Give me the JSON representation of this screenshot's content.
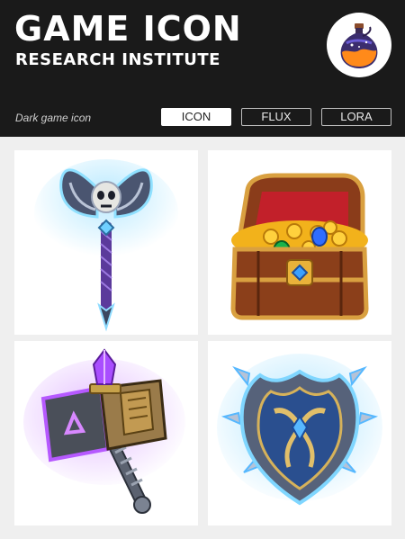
{
  "header": {
    "title": "GAME ICON",
    "subtitle": "RESEARCH INSTITUTE",
    "tagline": "Dark game icon"
  },
  "tabs": [
    {
      "label": "ICON",
      "active": true
    },
    {
      "label": "FLUX",
      "active": false
    },
    {
      "label": "LORA",
      "active": false
    }
  ],
  "logo": {
    "icon": "potion-bottle-icon"
  },
  "gallery": [
    {
      "icon": "skull-battle-axe-icon"
    },
    {
      "icon": "treasure-chest-icon"
    },
    {
      "icon": "crystal-war-hammer-icon"
    },
    {
      "icon": "spiked-shield-icon"
    }
  ],
  "colors": {
    "header_bg": "#1a1a1a",
    "page_bg": "#efefef",
    "card_bg": "#ffffff",
    "glow_blue": "#6fd0ff",
    "glow_purple": "#b34dff",
    "gold": "#f2b21b"
  }
}
